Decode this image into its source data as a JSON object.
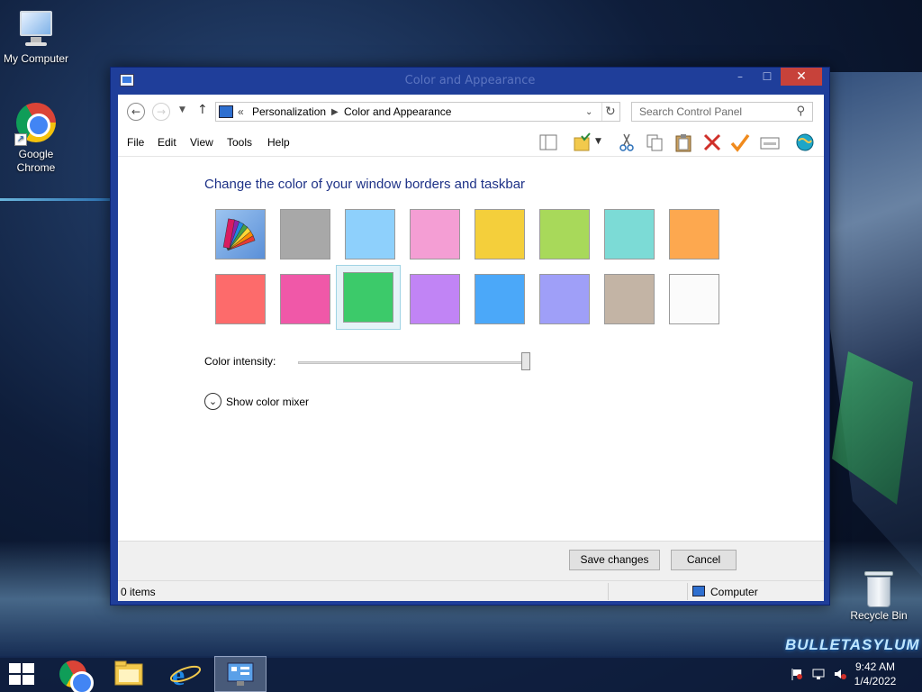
{
  "desktop": {
    "icons": [
      {
        "label": "My Computer"
      },
      {
        "label": "Google Chrome"
      },
      {
        "label": "Recycle Bin"
      }
    ],
    "brand_text": "BULLETASYLUM"
  },
  "window": {
    "title": "Color and Appearance",
    "address": {
      "crumbs": [
        "«",
        "Personalization",
        "Color and Appearance"
      ]
    },
    "search": {
      "placeholder": "Search Control Panel"
    },
    "menu": [
      "File",
      "Edit",
      "View",
      "Tools",
      "Help"
    ],
    "toolbar_icons": [
      "pane-icon",
      "folder-check-icon",
      "cut-icon",
      "copy-icon",
      "paste-icon",
      "delete-icon",
      "check-icon",
      "properties-icon",
      "globe-icon"
    ],
    "heading": "Change the color of your window borders and taskbar",
    "swatches": [
      {
        "name": "automatic",
        "color": "#6ea7e8"
      },
      {
        "name": "gray",
        "color": "#a8a8a8"
      },
      {
        "name": "sky",
        "color": "#8ed0fc"
      },
      {
        "name": "pink-light",
        "color": "#f49ed4"
      },
      {
        "name": "yellow",
        "color": "#f4cf3b"
      },
      {
        "name": "lime",
        "color": "#a8d95a"
      },
      {
        "name": "teal",
        "color": "#7cdbd6"
      },
      {
        "name": "orange",
        "color": "#fda84f"
      },
      {
        "name": "coral",
        "color": "#fd6b6b"
      },
      {
        "name": "magenta",
        "color": "#f058a8"
      },
      {
        "name": "green",
        "color": "#3cca6a"
      },
      {
        "name": "violet",
        "color": "#c184f5"
      },
      {
        "name": "blue",
        "color": "#4ba8f9"
      },
      {
        "name": "periwinkle",
        "color": "#9f9ff8"
      },
      {
        "name": "taupe",
        "color": "#c3b4a5"
      },
      {
        "name": "white",
        "color": "#fbfbfb"
      }
    ],
    "selected_swatch": "green",
    "intensity_label": "Color intensity:",
    "intensity_value": 1.0,
    "mixer_label": "Show color mixer",
    "buttons": {
      "save": "Save changes",
      "cancel": "Cancel"
    },
    "status": {
      "items": "0 items",
      "location": "Computer"
    }
  },
  "taskbar": {
    "apps": [
      "start",
      "chrome",
      "file-explorer",
      "internet-explorer",
      "control-panel"
    ],
    "active_app": "control-panel",
    "time": "9:42 AM",
    "date": "1/4/2022"
  }
}
